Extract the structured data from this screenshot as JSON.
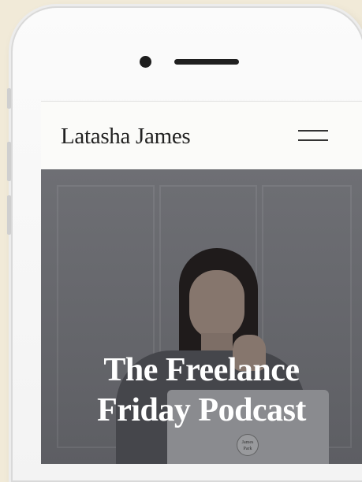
{
  "site": {
    "title": "Latasha James",
    "menu_icon": "hamburger-menu-icon"
  },
  "hero": {
    "heading_line1": "The Freelance",
    "heading_line2": "Friday Podcast",
    "laptop_logo_text": "James Park"
  },
  "colors": {
    "page_background": "#f1ead8",
    "header_background": "#fbfbf9",
    "hero_overlay": "#66676c",
    "heading_text": "#ffffff"
  }
}
